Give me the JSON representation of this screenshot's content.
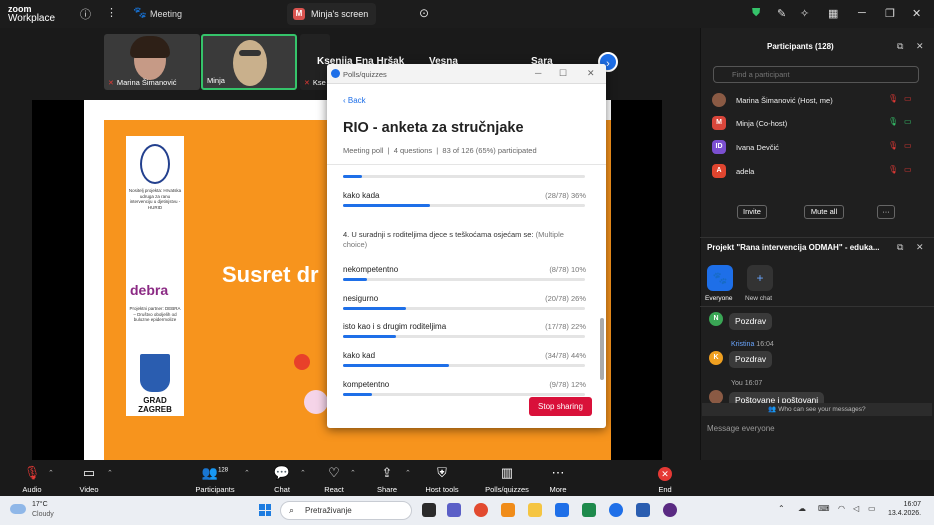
{
  "app": {
    "logo_top": "zoom",
    "logo_bottom": "Workplace"
  },
  "titlebar": {
    "meeting_label": "Meeting",
    "screen_tab_initial": "M",
    "screen_tab_label": "Minja's screen"
  },
  "filmstrip": {
    "tiles": [
      {
        "name": "Marina Šimanović"
      },
      {
        "name": "Minja"
      },
      {
        "name": "Ksenija Ena Hršak",
        "short": "Kse"
      }
    ],
    "names": [
      "Ksenija Ena Hršak",
      "Vesna",
      "Sara"
    ]
  },
  "slide": {
    "title": "Susret dr",
    "logo1_text": "Nositelj projekta: Hrvatska udruga za ranu intervenciju u djetinjstvu - HURID",
    "logo2_name": "debra",
    "logo2_text": "Projektni partner: DEBRA – Društvo oboljelih od bulozne epidermolize",
    "logo3_text": "GRAD ZAGREB"
  },
  "poll": {
    "window_title": "Polls/quizzes",
    "back": "Back",
    "title": "RIO - anketa za stručnjake",
    "meta_type": "Meeting poll",
    "meta_questions": "4 questions",
    "meta_participation": "83 of 126 (65%) participated",
    "prev_options": [
      {
        "label": "",
        "stat": "",
        "pct": 8
      },
      {
        "label": "kako kada",
        "stat": "(28/78) 36%",
        "pct": 36
      }
    ],
    "question": "4. U suradnji s roditeljima djece s teškoćama osjećam se:",
    "question_type": "(Multiple choice)",
    "options": [
      {
        "label": "nekompetentno",
        "stat": "(8/78) 10%",
        "pct": 10
      },
      {
        "label": "nesigurno",
        "stat": "(20/78) 26%",
        "pct": 26
      },
      {
        "label": "isto kao i s drugim roditeljima",
        "stat": "(17/78) 22%",
        "pct": 22
      },
      {
        "label": "kako kad",
        "stat": "(34/78) 44%",
        "pct": 44
      },
      {
        "label": "kompetentno",
        "stat": "(9/78) 12%",
        "pct": 12
      }
    ],
    "stop_sharing": "Stop sharing"
  },
  "participants": {
    "header": "Participants (128)",
    "search_placeholder": "Find a participant",
    "list": [
      {
        "initial": "",
        "name": "Marina Šimanović (Host, me)",
        "color": "#8a5a44"
      },
      {
        "initial": "M",
        "name": "Minja (Co-host)",
        "color": "#d9463b"
      },
      {
        "initial": "ID",
        "name": "Ivana Devčić",
        "color": "#7b4fd0"
      },
      {
        "initial": "A",
        "name": "adela",
        "color": "#e0452f"
      }
    ],
    "invite": "Invite",
    "mute_all": "Mute all",
    "more": "···"
  },
  "chat": {
    "header": "Projekt \"Rana intervencija ODMAH\" - eduka...",
    "tab_everyone": "Everyone",
    "tab_new": "New chat",
    "messages": [
      {
        "initial": "N",
        "color": "#3aa655",
        "text": "Pozdrav"
      },
      {
        "sender": "Kristina",
        "time": "16:04",
        "initial": "K",
        "color": "#f0a020",
        "text": "Pozdrav"
      },
      {
        "sender": "You",
        "time": "16:07",
        "text": "Poštovane i poštovani"
      }
    ],
    "who_can_see": "Who can see your messages?",
    "input_placeholder": "Message everyone"
  },
  "toolbar": {
    "audio": "Audio",
    "video": "Video",
    "participants": "Participants",
    "participants_count": "128",
    "chat": "Chat",
    "react": "React",
    "share": "Share",
    "host_tools": "Host tools",
    "polls": "Polls/quizzes",
    "more": "More",
    "end": "End"
  },
  "taskbar": {
    "temp": "17°C",
    "weather": "Cloudy",
    "search": "Pretraživanje",
    "time": "16:07",
    "date": "13.4.2026."
  }
}
